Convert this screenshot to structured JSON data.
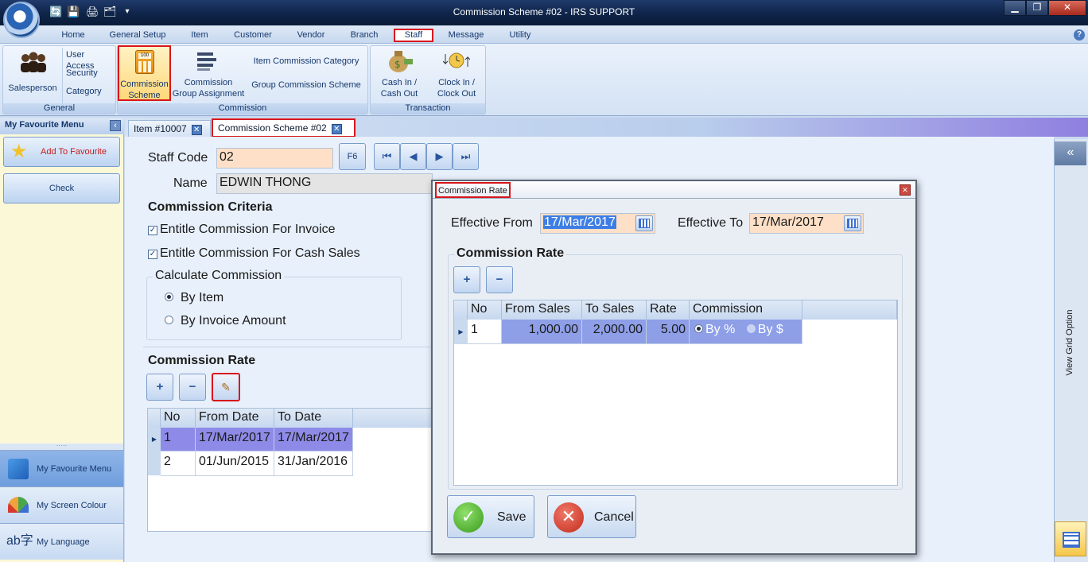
{
  "window": {
    "title": "Commission Scheme #02 - IRS SUPPORT",
    "min": "▁",
    "max": "❐",
    "close": "✕"
  },
  "qat": [
    "🔄",
    "💾",
    "🖨",
    "🗂",
    "▾"
  ],
  "menu": {
    "items": [
      "Home",
      "General Setup",
      "Item",
      "Customer",
      "Vendor",
      "Branch",
      "Staff",
      "Message",
      "Utility"
    ],
    "active": "Staff",
    "help": "?"
  },
  "ribbon": {
    "general": {
      "label": "General",
      "salesperson": "Salesperson",
      "user_access": "User Access",
      "security": "Security",
      "category": "Category"
    },
    "commission": {
      "label": "Commission",
      "scheme": "Commission Scheme",
      "group_assignment": "Commission Group Assignment",
      "item_category": "Item Commission Category",
      "group_scheme": "Group Commission Scheme"
    },
    "transaction": {
      "label": "Transaction",
      "cash": "Cash In / Cash Out",
      "clock": "Clock In / Clock Out"
    }
  },
  "sidebar": {
    "title": "My Favourite Menu",
    "collapse": "‹",
    "add": "Add To Favourite",
    "check": "Check",
    "grip": "·····",
    "bottom": [
      "My Favourite Menu",
      "My Screen Colour",
      "My Language"
    ]
  },
  "tabs": [
    {
      "label": "Item #10007",
      "close": "✕"
    },
    {
      "label": "Commission Scheme #02",
      "close": "✕"
    }
  ],
  "form": {
    "staff_code_label": "Staff Code",
    "staff_code": "02",
    "f6": "F6",
    "name_label": "Name",
    "name": "EDWIN THONG",
    "nav": [
      "⏮",
      "◀",
      "▶",
      "⏭"
    ],
    "criteria_title": "Commission Criteria",
    "invoice": "Entitle Commission For Invoice",
    "cash_sales": "Entitle Commission For Cash Sales",
    "calc_title": "Calculate Commission",
    "by_item": "By Item",
    "by_invoice": "By Invoice Amount",
    "rate_title": "Commission Rate",
    "add": "+",
    "remove": "−",
    "edit": "✎",
    "grid_headers": [
      "No",
      "From Date",
      "To Date"
    ],
    "rows": [
      [
        "1",
        "17/Mar/2017",
        "17/Mar/2017"
      ],
      [
        "2",
        "01/Jun/2015",
        "31/Jan/2016"
      ]
    ],
    "check_mark": "✓"
  },
  "dialog": {
    "title": "Commission Rate",
    "close": "✕",
    "eff_from_label": "Effective From",
    "eff_from": "17/Mar/2017",
    "eff_to_label": "Effective To",
    "eff_to": "17/Mar/2017",
    "rate_title": "Commission Rate",
    "add": "+",
    "remove": "−",
    "headers": [
      "No",
      "From Sales",
      "To Sales",
      "Rate",
      "Commission"
    ],
    "row": {
      "no": "1",
      "from": "1,000.00",
      "to": "2,000.00",
      "rate": "5.00",
      "by_pct": "By %",
      "by_amt": "By $"
    },
    "save": "Save",
    "cancel": "Cancel"
  },
  "right_panel": {
    "label": "View Grid Option",
    "collapse": "«"
  }
}
